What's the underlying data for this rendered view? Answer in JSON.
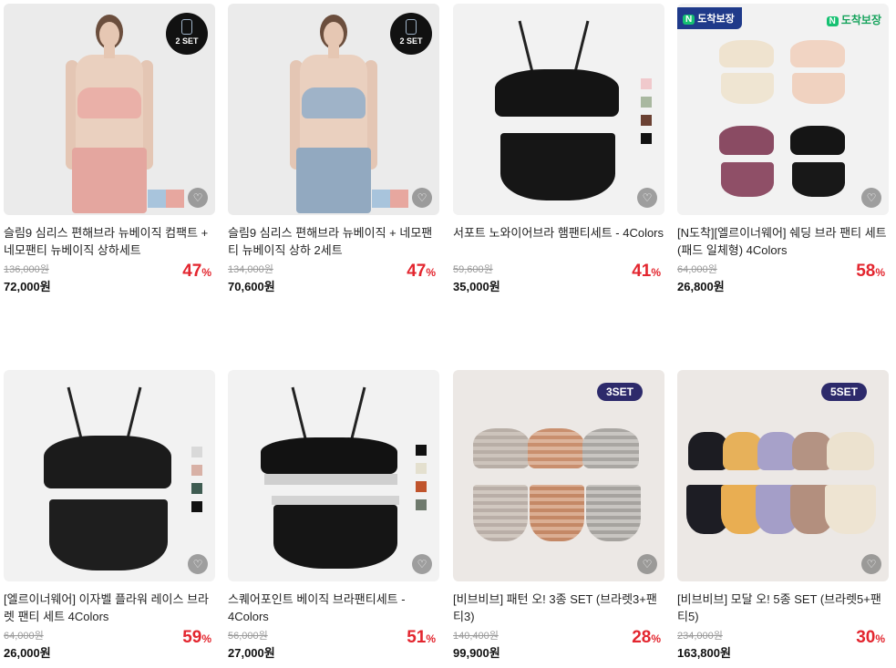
{
  "products": [
    {
      "title": "슬림9 심리스 편해브라 뉴베이직 컴팩트 + 네모팬티 뉴베이직 상하세트",
      "original_price": "136,000원",
      "price": "72,000원",
      "discount": "47",
      "discount_unit": "%",
      "badge": "2 SET",
      "accent": "#e9b2ab"
    },
    {
      "title": "슬림9 심리스 편해브라 뉴베이직 + 네모팬티 뉴베이직 상하 2세트",
      "original_price": "134,000원",
      "price": "70,600원",
      "discount": "47",
      "discount_unit": "%",
      "badge": "2 SET",
      "accent": "#9fb3c8"
    },
    {
      "title": "서포트 노와이어브라 햄팬티세트 - 4Colors",
      "original_price": "59,600원",
      "price": "35,000원",
      "discount": "41",
      "discount_unit": "%"
    },
    {
      "title": "[N도착][엘르이너웨어] 쉐딩 브라 팬티 세트 (패드 일체형) 4Colors",
      "original_price": "64,000원",
      "price": "26,800원",
      "discount": "58",
      "discount_unit": "%",
      "badge_left": "도착보장",
      "badge_right": "도착보장",
      "badge_n": "N"
    },
    {
      "title": "[엘르이너웨어] 이자벨 플라워 레이스 브라렛 팬티 세트 4Colors",
      "original_price": "64,000원",
      "price": "26,000원",
      "discount": "59",
      "discount_unit": "%"
    },
    {
      "title": "스퀘어포인트 베이직 브라팬티세트 - 4Colors",
      "original_price": "56,000원",
      "price": "27,000원",
      "discount": "51",
      "discount_unit": "%"
    },
    {
      "title": "[비브비브] 패턴 오! 3종 SET (브라렛3+팬티3)",
      "original_price": "140,400원",
      "price": "99,900원",
      "discount": "28",
      "discount_unit": "%",
      "badge": "3SET"
    },
    {
      "title": "[비브비브] 모달 오! 5종 SET (브라렛5+팬티5)",
      "original_price": "234,000원",
      "price": "163,800원",
      "discount": "30",
      "discount_unit": "%",
      "badge": "5SET"
    }
  ],
  "icons": {
    "wishlist": "heart-icon",
    "set": "set-icon"
  },
  "colors": {
    "discount": "#e3262f",
    "set_badge_bg": "#2d2a6b",
    "arrival_green": "#16c172"
  }
}
